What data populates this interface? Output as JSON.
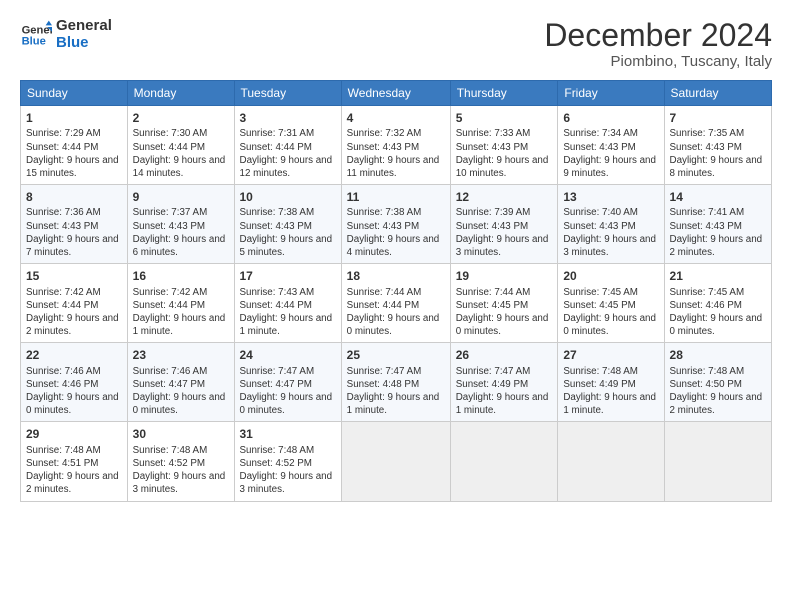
{
  "logo": {
    "line1": "General",
    "line2": "Blue"
  },
  "title": "December 2024",
  "subtitle": "Piombino, Tuscany, Italy",
  "days_of_week": [
    "Sunday",
    "Monday",
    "Tuesday",
    "Wednesday",
    "Thursday",
    "Friday",
    "Saturday"
  ],
  "weeks": [
    [
      {
        "day": "1",
        "info": "Sunrise: 7:29 AM\nSunset: 4:44 PM\nDaylight: 9 hours and 15 minutes."
      },
      {
        "day": "2",
        "info": "Sunrise: 7:30 AM\nSunset: 4:44 PM\nDaylight: 9 hours and 14 minutes."
      },
      {
        "day": "3",
        "info": "Sunrise: 7:31 AM\nSunset: 4:44 PM\nDaylight: 9 hours and 12 minutes."
      },
      {
        "day": "4",
        "info": "Sunrise: 7:32 AM\nSunset: 4:43 PM\nDaylight: 9 hours and 11 minutes."
      },
      {
        "day": "5",
        "info": "Sunrise: 7:33 AM\nSunset: 4:43 PM\nDaylight: 9 hours and 10 minutes."
      },
      {
        "day": "6",
        "info": "Sunrise: 7:34 AM\nSunset: 4:43 PM\nDaylight: 9 hours and 9 minutes."
      },
      {
        "day": "7",
        "info": "Sunrise: 7:35 AM\nSunset: 4:43 PM\nDaylight: 9 hours and 8 minutes."
      }
    ],
    [
      {
        "day": "8",
        "info": "Sunrise: 7:36 AM\nSunset: 4:43 PM\nDaylight: 9 hours and 7 minutes."
      },
      {
        "day": "9",
        "info": "Sunrise: 7:37 AM\nSunset: 4:43 PM\nDaylight: 9 hours and 6 minutes."
      },
      {
        "day": "10",
        "info": "Sunrise: 7:38 AM\nSunset: 4:43 PM\nDaylight: 9 hours and 5 minutes."
      },
      {
        "day": "11",
        "info": "Sunrise: 7:38 AM\nSunset: 4:43 PM\nDaylight: 9 hours and 4 minutes."
      },
      {
        "day": "12",
        "info": "Sunrise: 7:39 AM\nSunset: 4:43 PM\nDaylight: 9 hours and 3 minutes."
      },
      {
        "day": "13",
        "info": "Sunrise: 7:40 AM\nSunset: 4:43 PM\nDaylight: 9 hours and 3 minutes."
      },
      {
        "day": "14",
        "info": "Sunrise: 7:41 AM\nSunset: 4:43 PM\nDaylight: 9 hours and 2 minutes."
      }
    ],
    [
      {
        "day": "15",
        "info": "Sunrise: 7:42 AM\nSunset: 4:44 PM\nDaylight: 9 hours and 2 minutes."
      },
      {
        "day": "16",
        "info": "Sunrise: 7:42 AM\nSunset: 4:44 PM\nDaylight: 9 hours and 1 minute."
      },
      {
        "day": "17",
        "info": "Sunrise: 7:43 AM\nSunset: 4:44 PM\nDaylight: 9 hours and 1 minute."
      },
      {
        "day": "18",
        "info": "Sunrise: 7:44 AM\nSunset: 4:44 PM\nDaylight: 9 hours and 0 minutes."
      },
      {
        "day": "19",
        "info": "Sunrise: 7:44 AM\nSunset: 4:45 PM\nDaylight: 9 hours and 0 minutes."
      },
      {
        "day": "20",
        "info": "Sunrise: 7:45 AM\nSunset: 4:45 PM\nDaylight: 9 hours and 0 minutes."
      },
      {
        "day": "21",
        "info": "Sunrise: 7:45 AM\nSunset: 4:46 PM\nDaylight: 9 hours and 0 minutes."
      }
    ],
    [
      {
        "day": "22",
        "info": "Sunrise: 7:46 AM\nSunset: 4:46 PM\nDaylight: 9 hours and 0 minutes."
      },
      {
        "day": "23",
        "info": "Sunrise: 7:46 AM\nSunset: 4:47 PM\nDaylight: 9 hours and 0 minutes."
      },
      {
        "day": "24",
        "info": "Sunrise: 7:47 AM\nSunset: 4:47 PM\nDaylight: 9 hours and 0 minutes."
      },
      {
        "day": "25",
        "info": "Sunrise: 7:47 AM\nSunset: 4:48 PM\nDaylight: 9 hours and 1 minute."
      },
      {
        "day": "26",
        "info": "Sunrise: 7:47 AM\nSunset: 4:49 PM\nDaylight: 9 hours and 1 minute."
      },
      {
        "day": "27",
        "info": "Sunrise: 7:48 AM\nSunset: 4:49 PM\nDaylight: 9 hours and 1 minute."
      },
      {
        "day": "28",
        "info": "Sunrise: 7:48 AM\nSunset: 4:50 PM\nDaylight: 9 hours and 2 minutes."
      }
    ],
    [
      {
        "day": "29",
        "info": "Sunrise: 7:48 AM\nSunset: 4:51 PM\nDaylight: 9 hours and 2 minutes."
      },
      {
        "day": "30",
        "info": "Sunrise: 7:48 AM\nSunset: 4:52 PM\nDaylight: 9 hours and 3 minutes."
      },
      {
        "day": "31",
        "info": "Sunrise: 7:48 AM\nSunset: 4:52 PM\nDaylight: 9 hours and 3 minutes."
      },
      null,
      null,
      null,
      null
    ]
  ]
}
